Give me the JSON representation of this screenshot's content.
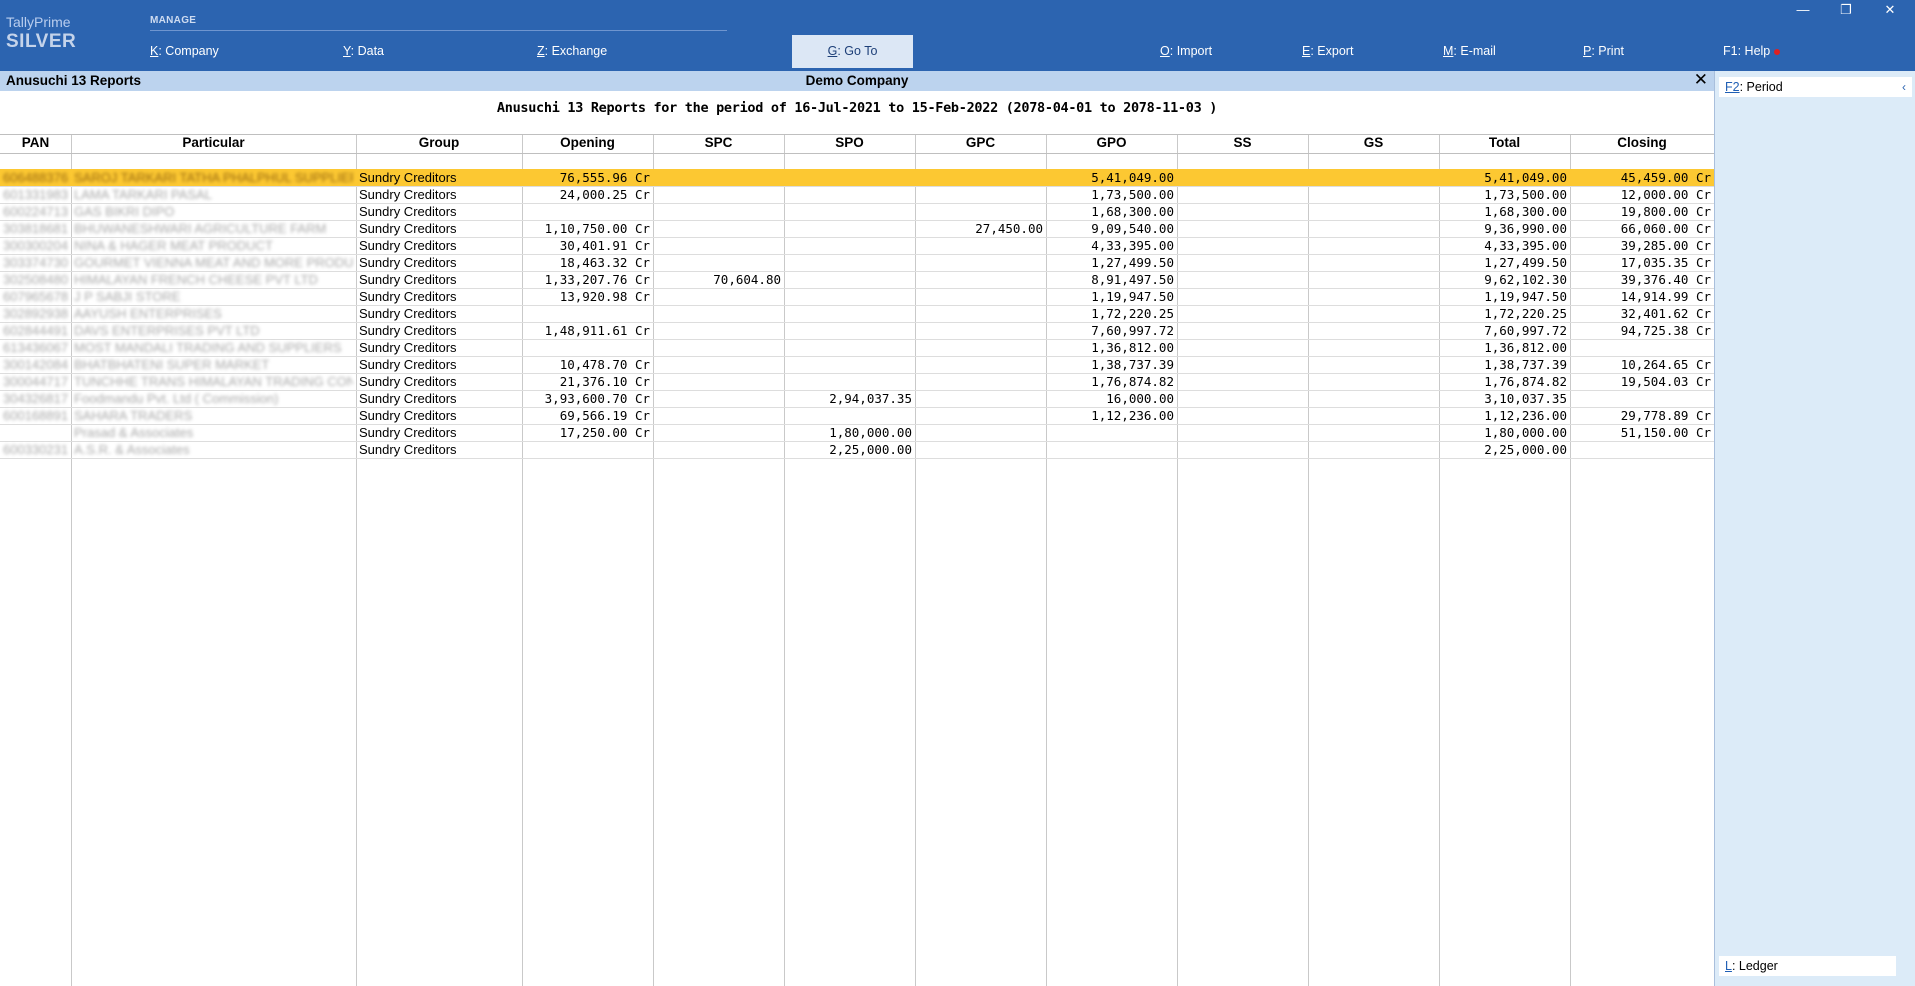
{
  "app": {
    "brand_line1": "TallyPrime",
    "brand_line2": "SILVER",
    "manage_label": "MANAGE",
    "menu": [
      {
        "key": "K",
        "label": "Company"
      },
      {
        "key": "Y",
        "label": "Data"
      },
      {
        "key": "Z",
        "label": "Exchange"
      },
      {
        "key": "G",
        "label": "Go To"
      },
      {
        "key": "O",
        "label": "Import"
      },
      {
        "key": "E",
        "label": "Export"
      },
      {
        "key": "M",
        "label": "E-mail"
      },
      {
        "key": "P",
        "label": "Print"
      },
      {
        "key": "F1",
        "label": "Help"
      }
    ],
    "window_controls": {
      "minimize": "—",
      "restore": "❐",
      "close": "✕"
    }
  },
  "report": {
    "name": "Anusuchi 13 Reports",
    "company": "Demo Company",
    "close_glyph": "✕",
    "title": "Anusuchi 13 Reports for the period of 16-Jul-2021 to 15-Feb-2022 (2078-04-01 to 2078-11-03 )"
  },
  "columns": [
    "PAN",
    "Particular",
    "Group",
    "Opening",
    "SPC",
    "SPO",
    "GPC",
    "GPO",
    "SS",
    "GS",
    "Total",
    "Closing"
  ],
  "rows": [
    {
      "pan": "606488376",
      "particular": "SAROJ TARKARI TATHA PHALPHUL SUPPLIERS",
      "group": "Sundry Creditors",
      "opening": "76,555.96 Cr",
      "spc": "",
      "spo": "",
      "gpc": "",
      "gpo": "5,41,049.00",
      "ss": "",
      "gs": "",
      "total": "5,41,049.00",
      "closing": "45,459.00 Cr",
      "selected": true
    },
    {
      "pan": "601331983",
      "particular": "LAMA TARKARI PASAL",
      "group": "Sundry Creditors",
      "opening": "24,000.25 Cr",
      "spc": "",
      "spo": "",
      "gpc": "",
      "gpo": "1,73,500.00",
      "ss": "",
      "gs": "",
      "total": "1,73,500.00",
      "closing": "12,000.00 Cr"
    },
    {
      "pan": "600224713",
      "particular": "GAS BIKRI DIPO",
      "group": "Sundry Creditors",
      "opening": "",
      "spc": "",
      "spo": "",
      "gpc": "",
      "gpo": "1,68,300.00",
      "ss": "",
      "gs": "",
      "total": "1,68,300.00",
      "closing": "19,800.00 Cr"
    },
    {
      "pan": "303818681",
      "particular": "BHUWANESHWARI AGRICULTURE FARM",
      "group": "Sundry Creditors",
      "opening": "1,10,750.00 Cr",
      "spc": "",
      "spo": "",
      "gpc": "27,450.00",
      "gpo": "9,09,540.00",
      "ss": "",
      "gs": "",
      "total": "9,36,990.00",
      "closing": "66,060.00 Cr"
    },
    {
      "pan": "300300204",
      "particular": "NINA & HAGER MEAT PRODUCT",
      "group": "Sundry Creditors",
      "opening": "30,401.91 Cr",
      "spc": "",
      "spo": "",
      "gpc": "",
      "gpo": "4,33,395.00",
      "ss": "",
      "gs": "",
      "total": "4,33,395.00",
      "closing": "39,285.00 Cr"
    },
    {
      "pan": "303374730",
      "particular": "GOURMET VIENNA MEAT AND MORE PRODUCTS PVT LTD",
      "group": "Sundry Creditors",
      "opening": "18,463.32 Cr",
      "spc": "",
      "spo": "",
      "gpc": "",
      "gpo": "1,27,499.50",
      "ss": "",
      "gs": "",
      "total": "1,27,499.50",
      "closing": "17,035.35 Cr"
    },
    {
      "pan": "302508480",
      "particular": "HIMALAYAN FRENCH CHEESE PVT LTD",
      "group": "Sundry Creditors",
      "opening": "1,33,207.76 Cr",
      "spc": "70,604.80",
      "spo": "",
      "gpc": "",
      "gpo": "8,91,497.50",
      "ss": "",
      "gs": "",
      "total": "9,62,102.30",
      "closing": "39,376.40 Cr"
    },
    {
      "pan": "607965678",
      "particular": "J P SABJI STORE",
      "group": "Sundry Creditors",
      "opening": "13,920.98 Cr",
      "spc": "",
      "spo": "",
      "gpc": "",
      "gpo": "1,19,947.50",
      "ss": "",
      "gs": "",
      "total": "1,19,947.50",
      "closing": "14,914.99 Cr"
    },
    {
      "pan": "302892938",
      "particular": "AAYUSH ENTERPRISES",
      "group": "Sundry Creditors",
      "opening": "",
      "spc": "",
      "spo": "",
      "gpc": "",
      "gpo": "1,72,220.25",
      "ss": "",
      "gs": "",
      "total": "1,72,220.25",
      "closing": "32,401.62 Cr"
    },
    {
      "pan": "602844491",
      "particular": "DAVS ENTERPRISES PVT LTD",
      "group": "Sundry Creditors",
      "opening": "1,48,911.61 Cr",
      "spc": "",
      "spo": "",
      "gpc": "",
      "gpo": "7,60,997.72",
      "ss": "",
      "gs": "",
      "total": "7,60,997.72",
      "closing": "94,725.38 Cr"
    },
    {
      "pan": "613436067",
      "particular": "MOST MANDALI TRADING AND SUPPLIERS",
      "group": "Sundry Creditors",
      "opening": "",
      "spc": "",
      "spo": "",
      "gpc": "",
      "gpo": "1,36,812.00",
      "ss": "",
      "gs": "",
      "total": "1,36,812.00",
      "closing": ""
    },
    {
      "pan": "300142084",
      "particular": "BHATBHATENI SUPER MARKET",
      "group": "Sundry Creditors",
      "opening": "10,478.70 Cr",
      "spc": "",
      "spo": "",
      "gpc": "",
      "gpo": "1,38,737.39",
      "ss": "",
      "gs": "",
      "total": "1,38,737.39",
      "closing": "10,264.65 Cr"
    },
    {
      "pan": "300044717",
      "particular": "TUNCHHE TRANS HIMALAYAN TRADING CONCERN",
      "group": "Sundry Creditors",
      "opening": "21,376.10 Cr",
      "spc": "",
      "spo": "",
      "gpc": "",
      "gpo": "1,76,874.82",
      "ss": "",
      "gs": "",
      "total": "1,76,874.82",
      "closing": "19,504.03 Cr"
    },
    {
      "pan": "304326817",
      "particular": "Foodmandu Pvt. Ltd ( Commission)",
      "group": "Sundry Creditors",
      "opening": "3,93,600.70 Cr",
      "spc": "",
      "spo": "2,94,037.35",
      "gpc": "",
      "gpo": "16,000.00",
      "ss": "",
      "gs": "",
      "total": "3,10,037.35",
      "closing": ""
    },
    {
      "pan": "600168891",
      "particular": "SAHARA TRADERS",
      "group": "Sundry Creditors",
      "opening": "69,566.19 Cr",
      "spc": "",
      "spo": "",
      "gpc": "",
      "gpo": "1,12,236.00",
      "ss": "",
      "gs": "",
      "total": "1,12,236.00",
      "closing": "29,778.89 Cr"
    },
    {
      "pan": "",
      "particular": "Prasad & Associates",
      "group": "Sundry Creditors",
      "opening": "17,250.00 Cr",
      "spc": "",
      "spo": "1,80,000.00",
      "gpc": "",
      "gpo": "",
      "ss": "",
      "gs": "",
      "total": "1,80,000.00",
      "closing": "51,150.00 Cr"
    },
    {
      "pan": "600330231",
      "particular": "A.S.R. & Associates",
      "group": "Sundry Creditors",
      "opening": "",
      "spc": "",
      "spo": "2,25,000.00",
      "gpc": "",
      "gpo": "",
      "ss": "",
      "gs": "",
      "total": "2,25,000.00",
      "closing": ""
    }
  ],
  "right_panel": {
    "period": {
      "key": "F2",
      "label": "Period"
    },
    "ledger": {
      "key": "L",
      "label": "Ledger"
    },
    "collapse_glyph": "‹"
  },
  "colors": {
    "topbar": "#2c64b0",
    "selected_row": "#fcc832",
    "report_header": "#bcd3ee",
    "panel": "#dcebf8"
  }
}
